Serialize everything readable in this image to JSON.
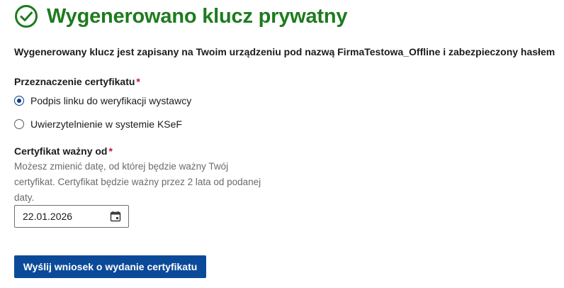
{
  "header": {
    "title": "Wygenerowano klucz prywatny",
    "icon": "check-circle-icon",
    "accent_color": "#1e7b1e"
  },
  "info_text": "Wygenerowany klucz jest zapisany na Twoim urządzeniu pod nazwą FirmaTestowa_Offline i zabezpieczony hasłem",
  "purpose": {
    "label": "Przeznaczenie certyfikatu",
    "required_mark": "*",
    "options": [
      {
        "label": "Podpis linku do weryfikacji wystawcy",
        "selected": true
      },
      {
        "label": "Uwierzytelnienie w systemie KSeF",
        "selected": false
      }
    ]
  },
  "valid_from": {
    "label": "Certyfikat ważny od",
    "required_mark": "*",
    "hint": "Możesz zmienić datę, od której będzie ważny Twój certyfikat. Certyfikat będzie ważny przez 2 lata od podanej daty.",
    "value": "22.01.2026",
    "icon": "calendar-icon"
  },
  "submit": {
    "label": "Wyślij wniosek o wydanie certyfikatu",
    "color": "#0b4a99"
  }
}
